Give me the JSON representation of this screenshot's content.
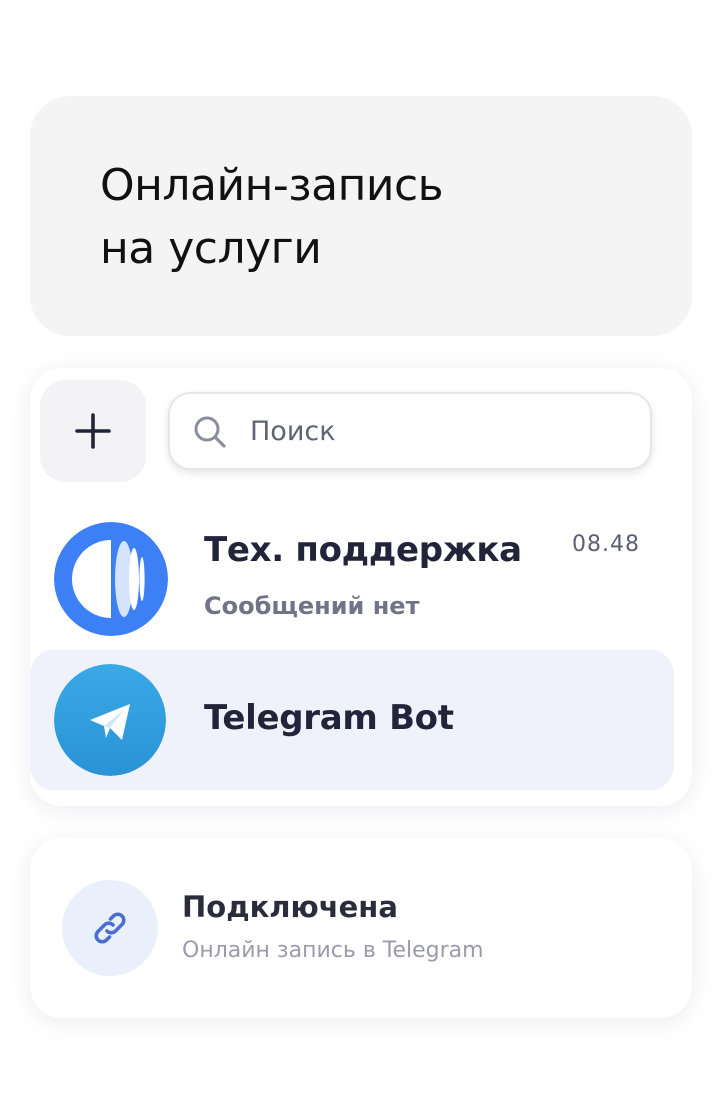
{
  "header": {
    "title_line1": "Онлайн-запись",
    "title_line2": "на услуги"
  },
  "search": {
    "placeholder": "Поиск",
    "value": ""
  },
  "chats": [
    {
      "name": "Тех. поддержка",
      "preview": "Сообщений нет",
      "time": "08.48",
      "avatar_icon": "support-logo-icon",
      "avatar_color": "#3d7ff5"
    },
    {
      "name": "Telegram Bot",
      "avatar_icon": "telegram-icon",
      "avatar_color": "#2aa3e0"
    }
  ],
  "integration": {
    "status": "Подключена",
    "description": "Онлайн запись в Telegram",
    "icon": "link-icon"
  },
  "colors": {
    "accent": "#3d7ff5",
    "selected_row": "#eff2fb",
    "header_card": "#f4f4f4"
  }
}
